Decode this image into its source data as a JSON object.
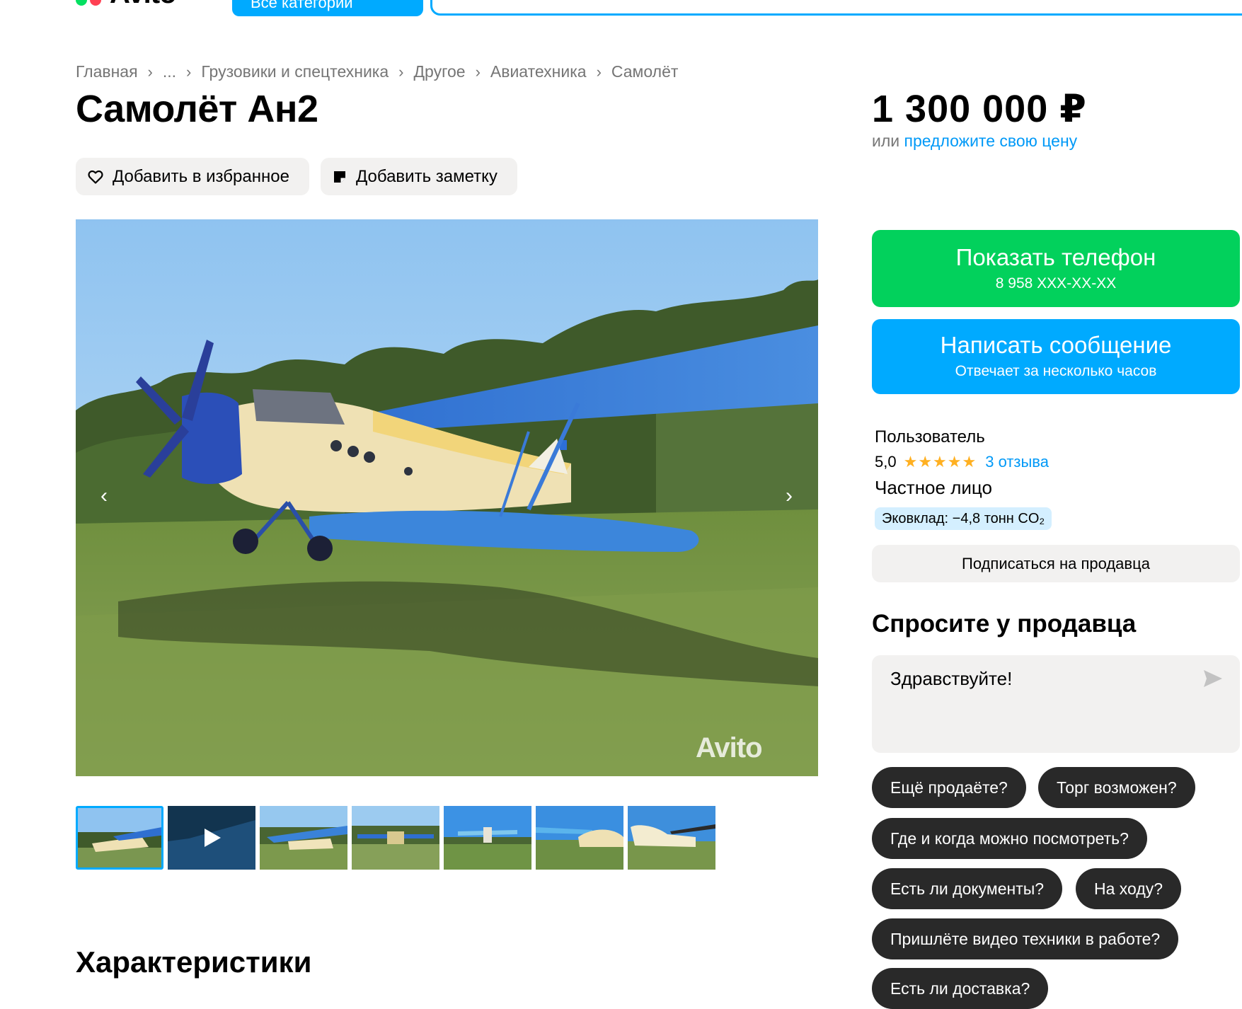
{
  "header": {
    "logo_text": "Avito",
    "categories_button": "Все категории"
  },
  "breadcrumb": [
    "Главная",
    "...",
    "Грузовики и спецтехника",
    "Другое",
    "Авиатехника",
    "Самолёт"
  ],
  "listing": {
    "title": "Самолёт Ан2",
    "favorite_label": "Добавить в избранное",
    "note_label": "Добавить заметку",
    "watermark": "Avito",
    "photo_count": 7,
    "characteristics_heading": "Характеристики"
  },
  "sidebar": {
    "price": "1 300 000 ₽",
    "offer_prefix": "или",
    "offer_link": "предложите свою цену",
    "show_phone": "Показать телефон",
    "phone_masked": "8 958 XXX-XX-XX",
    "write_message": "Написать сообщение",
    "reply_time": "Отвечает за несколько часов",
    "seller_name": "Пользователь",
    "rating": "5,0",
    "stars": "★★★★★",
    "reviews": "3 отзыва",
    "seller_type": "Частное лицо",
    "eco_label": "Эковклад: −4,8 тонн CO₂",
    "subscribe": "Подписаться на продавца",
    "ask_title": "Спросите у продавца",
    "ask_text": "Здравствуйте!",
    "quick_questions": [
      "Ещё продаёте?",
      "Торг возможен?",
      "Где и когда можно посмотреть?",
      "Есть ли документы?",
      "На ходу?",
      "Пришлёте видео техники в работе?",
      "Есть ли доставка?"
    ]
  },
  "colors": {
    "accent": "#00aaff",
    "green": "#02d15c",
    "link": "#0099f7",
    "star": "#ffb021",
    "chip": "#292929"
  }
}
